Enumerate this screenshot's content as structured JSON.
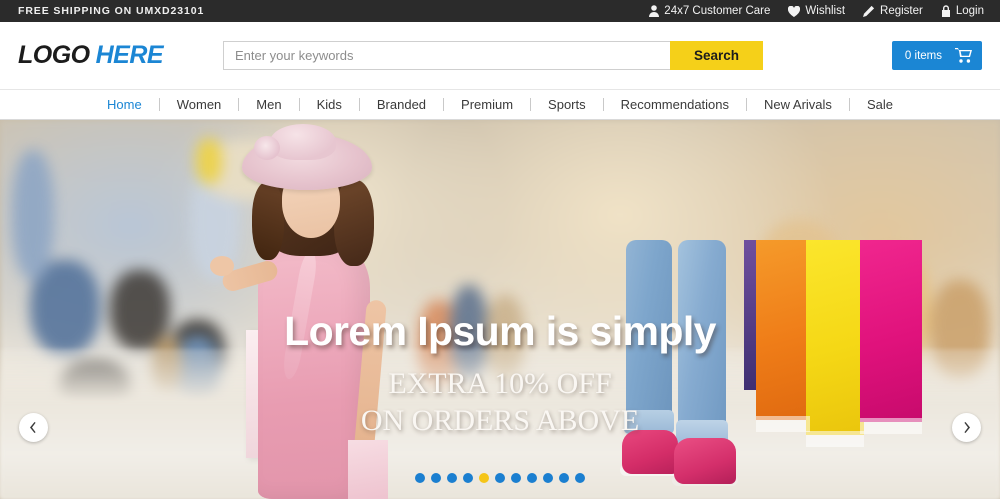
{
  "topbar": {
    "promo": "FREE SHIPPING ON UMXD23101",
    "links": [
      {
        "label": "24x7 Customer Care",
        "icon": "user-icon"
      },
      {
        "label": "Wishlist",
        "icon": "heart-icon"
      },
      {
        "label": "Register",
        "icon": "pencil-icon"
      },
      {
        "label": "Login",
        "icon": "lock-icon"
      }
    ],
    "bg_color": "#2b2b2b"
  },
  "header": {
    "logo_main": "LOGO",
    "logo_accent": "HERE",
    "logo_accent_color": "#1b86d4",
    "search": {
      "placeholder": "Enter your keywords",
      "value": "",
      "button_label": "Search",
      "button_color": "#f5d019"
    },
    "cart": {
      "count_label": "0 items",
      "icon": "shopping-cart-icon",
      "color": "#1b86d4"
    }
  },
  "nav": {
    "items": [
      {
        "label": "Home",
        "active": true
      },
      {
        "label": "Women",
        "active": false
      },
      {
        "label": "Men",
        "active": false
      },
      {
        "label": "Kids",
        "active": false
      },
      {
        "label": "Branded",
        "active": false
      },
      {
        "label": "Premium",
        "active": false
      },
      {
        "label": "Sports",
        "active": false
      },
      {
        "label": "Recommendations",
        "active": false
      },
      {
        "label": "New Arivals",
        "active": false
      },
      {
        "label": "Sale",
        "active": false
      }
    ],
    "active_color": "#1b86d4"
  },
  "hero": {
    "title": "Lorem Ipsum is simply",
    "subtitle_line1": "EXTRA 10% OFF",
    "subtitle_line2": "ON ORDERS ABOVE",
    "prev_icon": "chevron-left-icon",
    "next_icon": "chevron-right-icon",
    "dots": {
      "total": 11,
      "active_index": 4,
      "color": "#1b7fd0",
      "active_color": "#f5c518"
    }
  }
}
